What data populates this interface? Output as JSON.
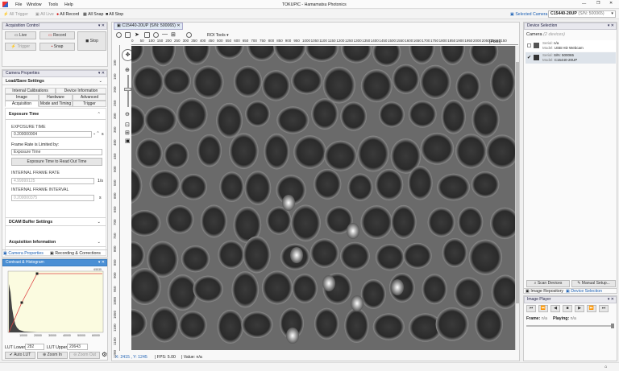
{
  "app": {
    "title": "TOKUPIC - Hamamatsu Photonics",
    "menu": [
      "File",
      "Window",
      "Tools",
      "Help"
    ]
  },
  "toolbar": {
    "all_trigger": "All Trigger",
    "all_live": "All Live",
    "all_record": "All Record",
    "all_snap": "All Snap",
    "all_stop": "All Stop",
    "selected_camera_label": "Selected Camera",
    "selected_camera_value": "C15440-20UP",
    "selected_camera_serial": "(S/N: 500065)"
  },
  "acq": {
    "title": "Acquisition Control",
    "live": "Live",
    "record": "Record",
    "stop": "Stop",
    "trigger": "Trigger",
    "snap": "Snap"
  },
  "camprops": {
    "title": "Camera Properties",
    "load_save": "Load/Save Settings",
    "tabs_row1": [
      "Internal Calibrations",
      "Device Information"
    ],
    "tabs_row2": [
      "Image",
      "Hardware",
      "Advanced"
    ],
    "tabs_row3": [
      "Acquisition",
      "Mode and Timing",
      "Trigger"
    ],
    "exposure_title": "Exposure Time",
    "exposure_label": "EXPOSURE TIME",
    "exposure_value": "0.200000004",
    "exposure_unit": "s",
    "frame_rate_label": "Frame Rate is Limited by:",
    "frame_rate_value": "Exposure Time",
    "readout_button": "Exposure Time to Read Out Time",
    "ifr_label": "INTERNAL FRAME RATE",
    "ifr_value": "4.99999125",
    "ifr_unit": "1/s",
    "ifi_label": "INTERNAL FRAME INTERVAL",
    "ifi_value": "0.200000375",
    "ifi_unit": "s",
    "dcam_buffer": "DCAM Buffer Settings",
    "acq_info": "Acquisition Information",
    "bottom_tabs": [
      "Camera Properties",
      "Recording & Corrections"
    ]
  },
  "hist": {
    "title": "Contrast & Histogram",
    "top_value": "65535",
    "xticks": [
      "10000",
      "20000",
      "30000",
      "40000",
      "50000",
      "60000"
    ],
    "lut_lower_label": "LUT Lower",
    "lut_lower": "282",
    "lut_upper_label": "LUT Upper",
    "lut_upper": "20643",
    "auto_lut": "Auto LUT",
    "zoom_in": "Zoom In",
    "zoom_out": "Zoom Out"
  },
  "viewer": {
    "tab": "C15440-20UP (S/N: 500065)",
    "roi_tools": "ROI Tools",
    "pixel_label": "[Pixel]",
    "xticks": [
      "0",
      "50",
      "100",
      "150",
      "200",
      "250",
      "300",
      "350",
      "400",
      "450",
      "500",
      "550",
      "600",
      "650",
      "700",
      "750",
      "800",
      "850",
      "900",
      "950",
      "1000",
      "1050",
      "1100",
      "1150",
      "1200",
      "1250",
      "1300",
      "1350",
      "1400",
      "1450",
      "1500",
      "1550",
      "1600",
      "1650",
      "1700",
      "1750",
      "1800",
      "1850",
      "1900",
      "1950",
      "2000",
      "2050",
      "2100",
      "2150"
    ],
    "yticks": [
      "100",
      "150",
      "200",
      "250",
      "300",
      "350",
      "400",
      "450",
      "500",
      "550",
      "600",
      "650",
      "700",
      "750",
      "800",
      "850",
      "900",
      "950",
      "1000",
      "1050",
      "1100",
      "1150",
      "1200"
    ],
    "status_xy": "X: 2415 , Y: 1245",
    "status_fps": "FPS: 5.00",
    "status_value": "Value: n/a"
  },
  "devices": {
    "title": "Device Selection",
    "camera_label": "Camera",
    "camera_count": "(2 devices)",
    "list": [
      {
        "serial_label": "Serial:",
        "serial": "n/a",
        "model_label": "Model:",
        "model": "USB HD Webcam",
        "checked": false
      },
      {
        "serial_label": "Serial:",
        "serial": "S/N: 500065",
        "model_label": "Model:",
        "model": "C15440-20UP",
        "checked": true
      }
    ],
    "scan": "Scan Devices",
    "manual": "Manual Setup...",
    "tab_repo": "Image Repository",
    "tab_dev": "Device Selection"
  },
  "player": {
    "title": "Image Player",
    "frame_label": "Frame:",
    "frame_value": "n/a",
    "playing_label": "Playing:",
    "playing_value": "n/a"
  }
}
